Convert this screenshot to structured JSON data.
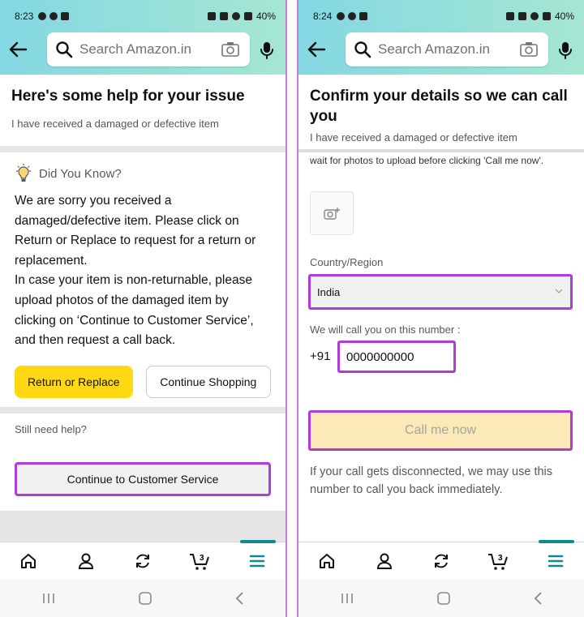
{
  "left": {
    "status": {
      "time": "8:23",
      "battery": "40%"
    },
    "search": {
      "placeholder": "Search Amazon.in"
    },
    "header": {
      "title": "Here's some help for your issue",
      "subtitle": "I have received a damaged or defective item"
    },
    "did_you_know": {
      "heading": "Did You Know?",
      "body_1": "We are sorry you received a damaged/defective item. Please click on Return or Replace to request for a return or replacement.",
      "body_2": "In case your item is non-returnable, please upload photos of the damaged item by clicking on ‘Continue to Customer Service’, and then request a call back."
    },
    "buttons": {
      "return_replace": "Return or Replace",
      "continue_shopping": "Continue Shopping"
    },
    "still_need_help": "Still need help?",
    "customer_service_button": "Continue to Customer Service"
  },
  "right": {
    "status": {
      "time": "8:24",
      "battery": "40%"
    },
    "search": {
      "placeholder": "Search Amazon.in"
    },
    "header": {
      "title": "Confirm your details so we can call you",
      "subtitle": "I have received a damaged or defective item"
    },
    "scrolled_text": "wait for photos to upload before clicking 'Call me now'.",
    "country_label": "Country/Region",
    "country_value": "India",
    "call_label": "We will call you on this number :",
    "phone_prefix": "+91",
    "phone_value": "0000000000",
    "call_button": "Call me now",
    "disconnect_note": "If your call gets disconnected, we may use this number to call you back immediately."
  },
  "nav": {
    "items": [
      "home-icon",
      "account-icon",
      "refresh-icon",
      "cart-icon",
      "menu-icon"
    ],
    "cart_count": "3",
    "accent_color": "#0e8a93"
  },
  "colors": {
    "highlight": "#b03bd9",
    "yellow_button": "#ffd814",
    "call_button_disabled": "#fce9b8",
    "topbar_start": "#84d8e3",
    "topbar_end": "#a5e6d2"
  }
}
